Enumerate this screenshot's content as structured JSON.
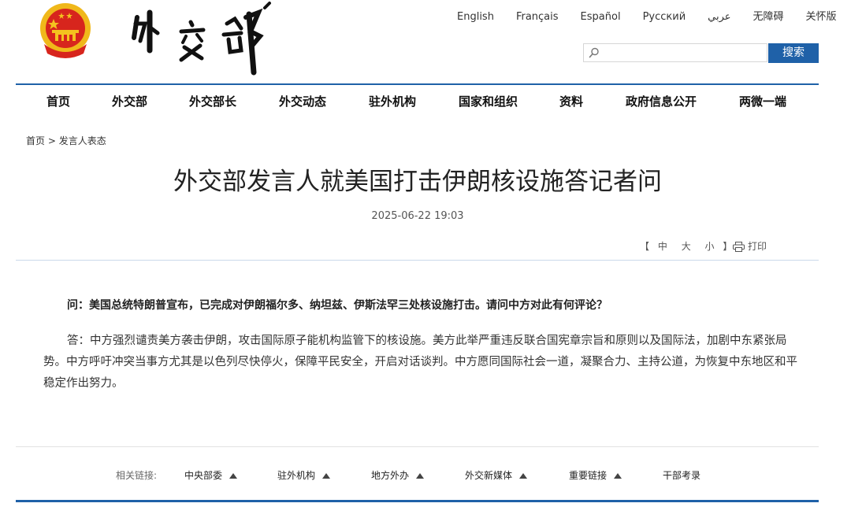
{
  "header": {
    "languages": [
      "English",
      "Français",
      "Español",
      "Русский",
      "عربي",
      "无障碍",
      "关怀版"
    ],
    "search": {
      "placeholder": "",
      "button_label": "搜索"
    }
  },
  "nav": {
    "items": [
      "首页",
      "外交部",
      "外交部长",
      "外交动态",
      "驻外机构",
      "国家和组织",
      "资料",
      "政府信息公开",
      "两微一端"
    ]
  },
  "breadcrumb": {
    "home": "首页",
    "separator": " > ",
    "current": "发言人表态"
  },
  "article": {
    "title": "外交部发言人就美国打击伊朗核设施答记者问",
    "date": "2025-06-22 19:03",
    "font_size": {
      "open": "【",
      "large": "中",
      "medium": "大",
      "small": "小",
      "close": "】"
    },
    "print_label": "打印",
    "question": "问：美国总统特朗普宣布，已完成对伊朗福尔多、纳坦兹、伊斯法罕三处核设施打击。请问中方对此有何评论？",
    "answer": "答：中方强烈谴责美方袭击伊朗，攻击国际原子能机构监管下的核设施。美方此举严重违反联合国宪章宗旨和原则以及国际法，加剧中东紧张局势。中方呼吁冲突当事方尤其是以色列尽快停火，保障平民安全，开启对话谈判。中方愿同国际社会一道，凝聚合力、主持公道，为恢复中东地区和平稳定作出努力。"
  },
  "footer": {
    "related_label": "相关链接:",
    "links": [
      "中央部委",
      "驻外机构",
      "地方外办",
      "外交新媒体",
      "重要链接",
      "干部考录"
    ]
  },
  "colors": {
    "accent": "#1f61a8",
    "emblem_red": "#d7251d",
    "emblem_gold": "#f4c21f"
  },
  "icons": {
    "emblem": "national-emblem-icon",
    "search": "search-icon",
    "print": "printer-icon",
    "dropdown": "triangle-up-icon"
  }
}
